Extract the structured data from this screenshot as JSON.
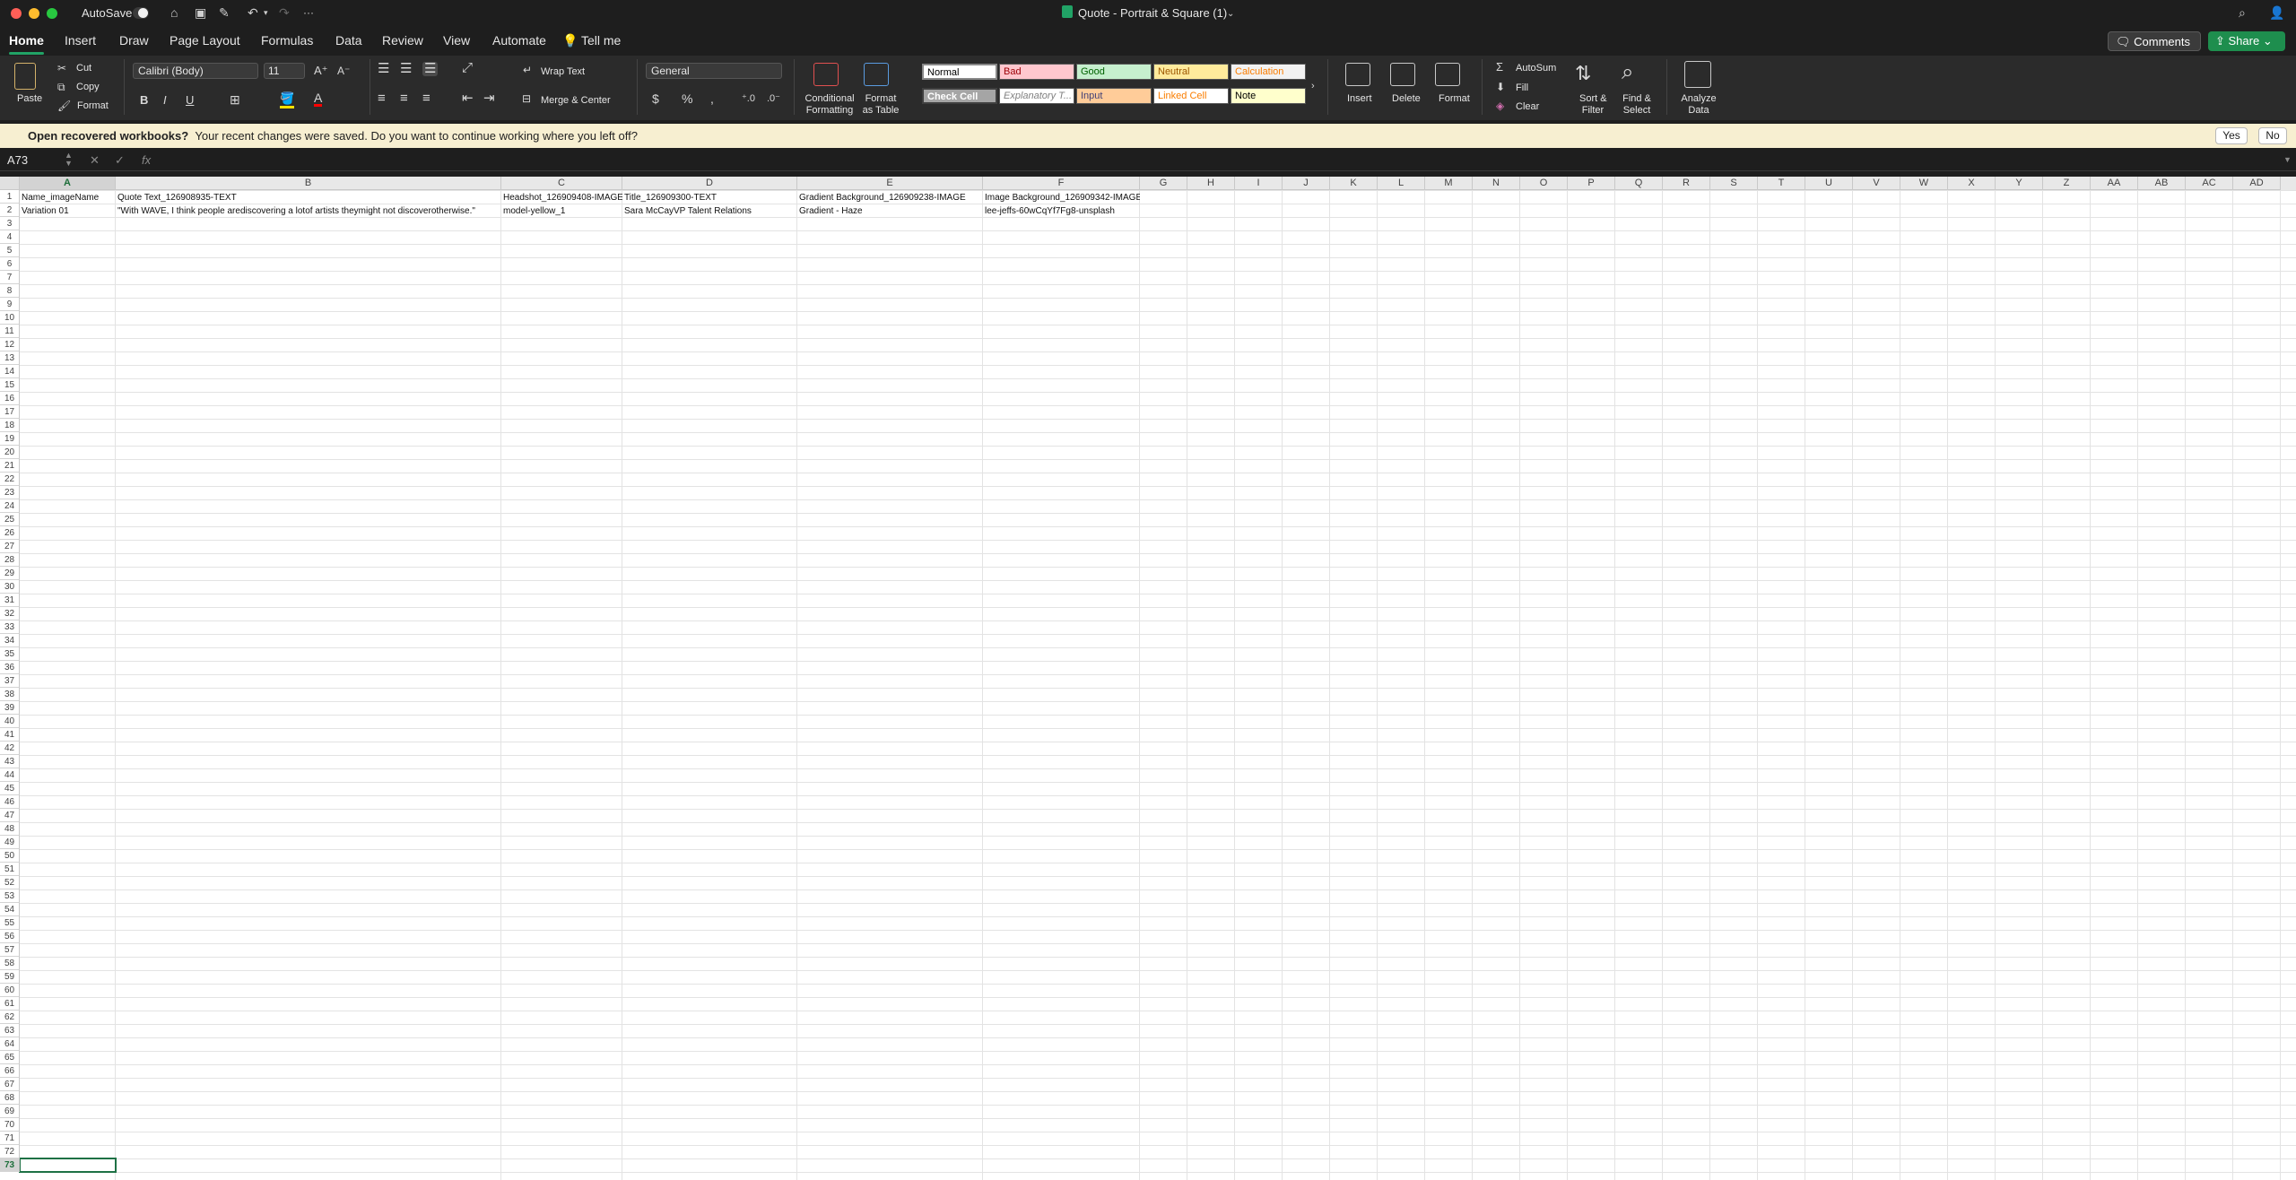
{
  "titlebar": {
    "autosave_label": "AutoSave",
    "document_title": "Quote - Portrait & Square (1)",
    "more_label": "···"
  },
  "tabs": [
    "Home",
    "Insert",
    "Draw",
    "Page Layout",
    "Formulas",
    "Data",
    "Review",
    "View",
    "Automate"
  ],
  "tell_me_label": "Tell me",
  "comments_label": "Comments",
  "share_label": "Share",
  "ribbon": {
    "paste_label": "Paste",
    "cut_label": "Cut",
    "copy_label": "Copy",
    "format_label": "Format",
    "font_name": "Calibri (Body)",
    "font_size": "11",
    "bold": "B",
    "italic": "I",
    "underline": "U",
    "wrap_text_label": "Wrap Text",
    "merge_center_label": "Merge & Center",
    "number_format": "General",
    "conditional_formatting_label": [
      "Conditional",
      "Formatting"
    ],
    "format_as_table_label": [
      "Format",
      "as Table"
    ],
    "styles": [
      {
        "label": "Normal",
        "bg": "#ffffff",
        "fg": "#000000"
      },
      {
        "label": "Bad",
        "bg": "#ffc7ce",
        "fg": "#9c0006"
      },
      {
        "label": "Good",
        "bg": "#c6efce",
        "fg": "#006100"
      },
      {
        "label": "Neutral",
        "bg": "#ffeb9c",
        "fg": "#9c5700"
      },
      {
        "label": "Calculation",
        "bg": "#f2f2f2",
        "fg": "#fa7d00"
      },
      {
        "label": "Check Cell",
        "bg": "#a5a5a5",
        "fg": "#ffffff"
      },
      {
        "label": "Explanatory T...",
        "bg": "#ffffff",
        "fg": "#7f7f7f"
      },
      {
        "label": "Input",
        "bg": "#ffcc99",
        "fg": "#3f3f76"
      },
      {
        "label": "Linked Cell",
        "bg": "#ffffff",
        "fg": "#fa7d00"
      },
      {
        "label": "Note",
        "bg": "#ffffcc",
        "fg": "#000000"
      }
    ],
    "insert_label": "Insert",
    "delete_label": "Delete",
    "format_cells_label": "Format",
    "autosum_label": "AutoSum",
    "fill_label": "Fill",
    "clear_label": "Clear",
    "sort_filter_label": [
      "Sort &",
      "Filter"
    ],
    "find_select_label": [
      "Find &",
      "Select"
    ],
    "analyze_data_label": [
      "Analyze",
      "Data"
    ]
  },
  "infobar": {
    "bold_text": "Open recovered workbooks?",
    "message": "Your recent changes were saved. Do you want to continue working where you left off?",
    "yes_label": "Yes",
    "no_label": "No"
  },
  "formula_bar": {
    "name_box": "A73",
    "fx_label": "fx",
    "content": ""
  },
  "sheet": {
    "columns": [
      "A",
      "B",
      "C",
      "D",
      "E",
      "F",
      "G",
      "H",
      "I",
      "J",
      "K",
      "L",
      "M",
      "N",
      "O",
      "P",
      "Q",
      "R",
      "S",
      "T",
      "U",
      "V",
      "W",
      "X",
      "Y",
      "Z",
      "AA",
      "AB",
      "AC",
      "AD"
    ],
    "row_count": 73,
    "selected_col": "A",
    "selected_row": 73,
    "rows": [
      [
        "Name_imageName",
        "Quote Text_126908935-TEXT",
        "Headshot_126909408-IMAGE",
        "Title_126909300-TEXT",
        "Gradient Background_126909238-IMAGE",
        "Image Background_126909342-IMAGE"
      ],
      [
        "Variation 01",
        "\"With WAVE, I think people arediscovering a lotof artists theymight not discoverotherwise.\"",
        "model-yellow_1",
        "Sara McCayVP Talent Relations",
        "Gradient - Haze",
        "lee-jeffs-60wCqYf7Fg8-unsplash"
      ]
    ]
  },
  "colors": {
    "accent": "#21a366",
    "selection": "#1e7145",
    "share": "#1e8e4e"
  }
}
